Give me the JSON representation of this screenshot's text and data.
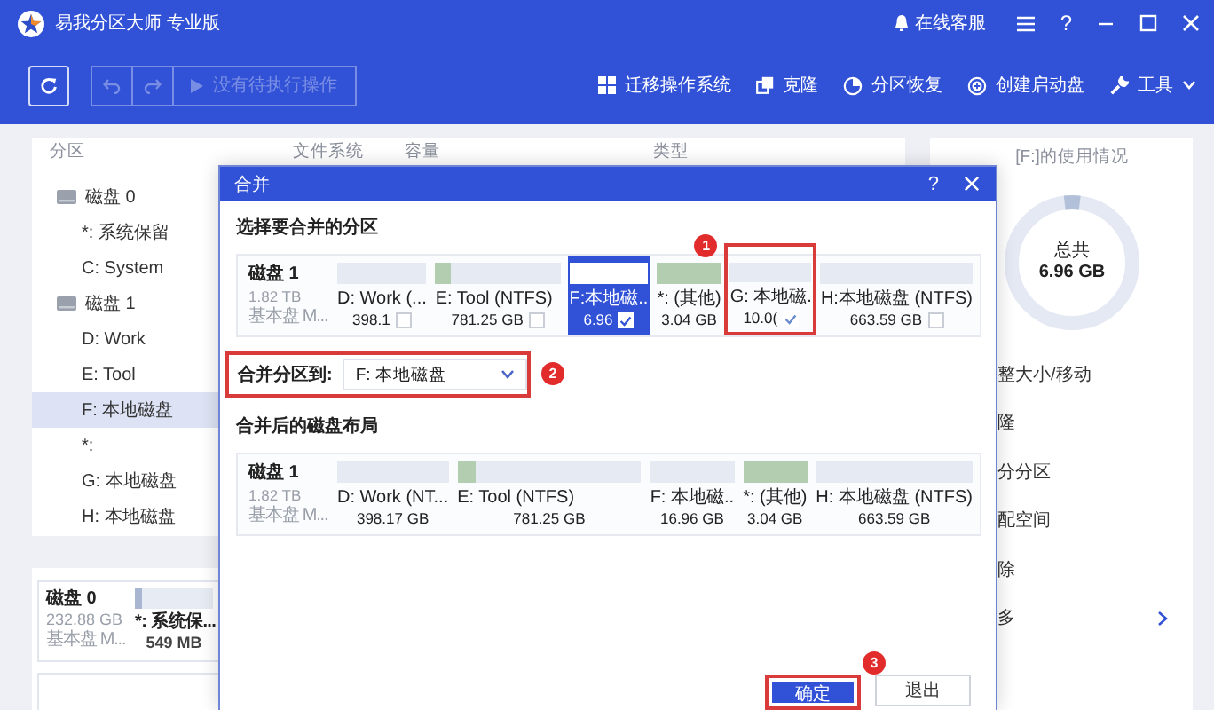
{
  "app": {
    "title": "易我分区大师 专业版",
    "support": "在线客服",
    "help": "?"
  },
  "toolbar": {
    "pending": "没有待执行操作",
    "pending_disabled": true,
    "actions": [
      {
        "label": "迁移操作系统",
        "kind": "windows"
      },
      {
        "label": "克隆",
        "kind": "clone"
      },
      {
        "label": "分区恢复",
        "kind": "recover"
      },
      {
        "label": "创建启动盘",
        "kind": "bootdisk"
      },
      {
        "label": "工具",
        "kind": "tools"
      }
    ]
  },
  "partition_list": {
    "columns": [
      "分区",
      "文件系统",
      "容量",
      "类型"
    ],
    "rows": [
      {
        "label": "磁盘 0",
        "kind": "disk",
        "selected": false
      },
      {
        "label": "*: 系统保留",
        "kind": "partition",
        "selected": false
      },
      {
        "label": "C: System",
        "kind": "partition",
        "selected": false
      },
      {
        "label": "磁盘 1",
        "kind": "disk",
        "selected": false
      },
      {
        "label": "D: Work",
        "kind": "partition",
        "selected": false
      },
      {
        "label": "E: Tool",
        "kind": "partition",
        "selected": false
      },
      {
        "label": "F: 本地磁盘",
        "kind": "partition",
        "selected": true
      },
      {
        "label": "*:",
        "kind": "partition",
        "selected": false
      },
      {
        "label": "G: 本地磁盘",
        "kind": "partition",
        "selected": false
      },
      {
        "label": "H: 本地磁盘",
        "kind": "partition",
        "selected": false
      }
    ]
  },
  "disk_cards": [
    {
      "name": "磁盘 0",
      "size": "232.88 GB",
      "type": "基本盘 M...",
      "partitions": [
        {
          "label": "*: 系统保...",
          "size": "549 MB",
          "level": 0.08
        }
      ]
    }
  ],
  "usage": {
    "title": "[F:]的使用情况",
    "total_label": "总共",
    "total": "6.96 GB",
    "level": 0.04,
    "menu": [
      {
        "label": "整大小/移动"
      },
      {
        "label": "隆"
      },
      {
        "label": "分分区"
      },
      {
        "label": "配空间"
      },
      {
        "label": "除"
      },
      {
        "label": "多",
        "submenu": true
      }
    ]
  },
  "dialog": {
    "title": "合并",
    "help": "?",
    "select_heading": "选择要合并的分区",
    "source": {
      "disk": "磁盘 1",
      "size": "1.82 TB",
      "type": "基本盘 M...",
      "partitions": [
        {
          "label": "D: Work (...",
          "size": "398.1",
          "level": 0,
          "kind": "partition",
          "checked": false,
          "selected": false
        },
        {
          "label": "E: Tool (NTFS)",
          "size": "781.25 GB",
          "level": 0.12,
          "kind": "partition",
          "checked": false,
          "selected": false
        },
        {
          "label": "F:本地磁..",
          "size": "6.96",
          "level": 0,
          "kind": "partition",
          "checked": true,
          "selected": true
        },
        {
          "label": "*: (其他)",
          "size": "3.04 GB",
          "level": 1,
          "kind": "other",
          "selected": false
        },
        {
          "label": "G: 本地磁.",
          "size": "10.0(",
          "level": 0,
          "kind": "partition",
          "checked": true,
          "selected": false,
          "callout": "1"
        },
        {
          "label": "H:本地磁盘 (NTFS)",
          "size": "663.59 GB",
          "level": 0,
          "kind": "partition",
          "checked": false,
          "selected": false
        }
      ]
    },
    "merge_to": {
      "label": "合并分区到:",
      "value": "F: 本地磁盘",
      "callout": "2"
    },
    "result_heading": "合并后的磁盘布局",
    "result": {
      "disk": "磁盘 1",
      "size": "1.82 TB",
      "type": "基本盘 M...",
      "partitions": [
        {
          "label": "D: Work (NT...",
          "size": "398.17 GB",
          "level": 0
        },
        {
          "label": "E: Tool (NTFS)",
          "size": "781.25 GB",
          "level": 0.1
        },
        {
          "label": "F: 本地磁..",
          "size": "16.96 GB",
          "level": 0
        },
        {
          "label": "*: (其他)",
          "size": "3.04 GB",
          "level": 1
        },
        {
          "label": "H: 本地磁盘 (NTFS)",
          "size": "663.59 GB",
          "level": 0
        }
      ]
    },
    "buttons": [
      {
        "label": "确定",
        "kind": "primary",
        "callout": "3"
      },
      {
        "label": "退出",
        "kind": "secondary"
      }
    ]
  }
}
